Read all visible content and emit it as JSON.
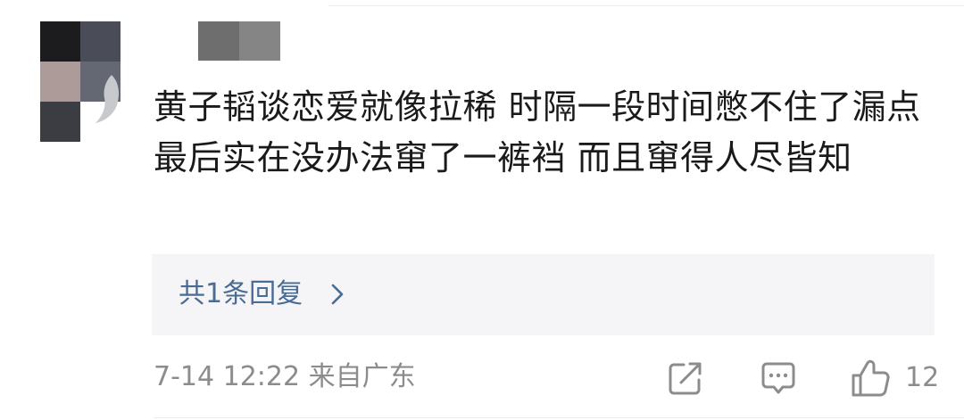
{
  "comment": {
    "text": "黄子韬谈恋爱就像拉稀 时隔一段时间憋不住了漏点 最后实在没办法窜了一裤裆 而且窜得人尽皆知"
  },
  "replies": {
    "label": "共1条回复"
  },
  "meta": {
    "time_location": "7-14 12:22 来自广东"
  },
  "actions": {
    "like_count": "12"
  },
  "icons": {
    "share": "share-icon",
    "comment": "comment-icon",
    "like": "thumbs-up-icon",
    "chevron": "chevron-right-icon"
  },
  "colors": {
    "reply_link": "#4a6b92",
    "meta_text": "#8c8c8c",
    "reply_background": "#f5f5f7"
  }
}
